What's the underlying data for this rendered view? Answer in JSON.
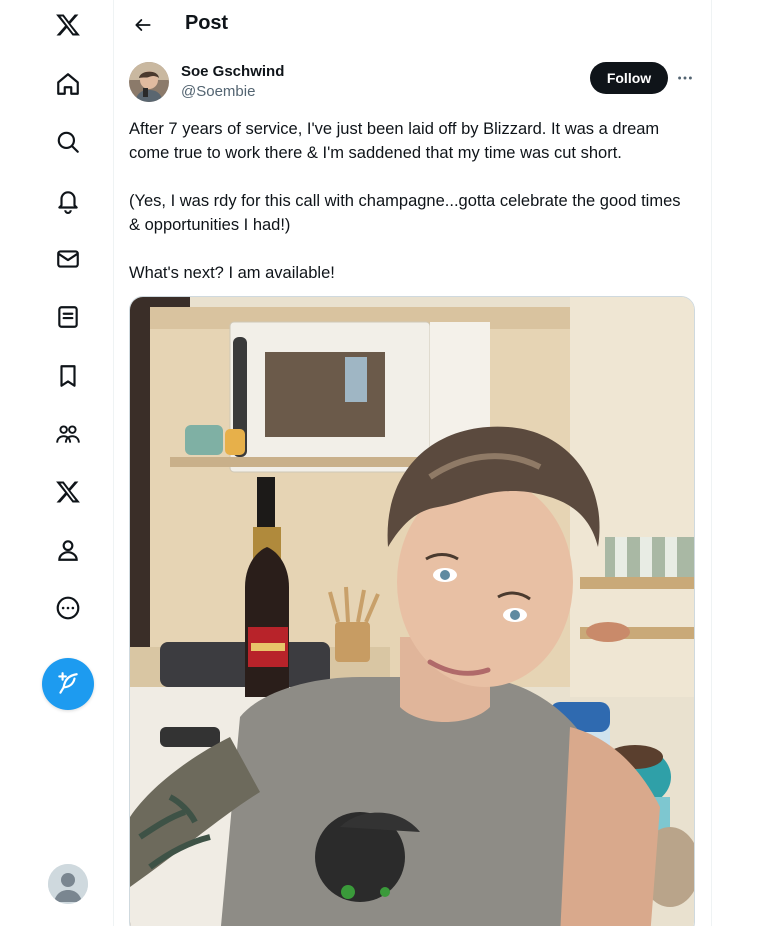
{
  "nav": {
    "items": [
      {
        "name": "x-logo-icon"
      },
      {
        "name": "home-icon"
      },
      {
        "name": "search-icon"
      },
      {
        "name": "notifications-icon"
      },
      {
        "name": "messages-icon"
      },
      {
        "name": "lists-icon"
      },
      {
        "name": "bookmarks-icon"
      },
      {
        "name": "communities-icon"
      },
      {
        "name": "premium-x-icon"
      },
      {
        "name": "profile-icon"
      },
      {
        "name": "more-icon"
      }
    ],
    "post_button_icon": "feather-plus-icon"
  },
  "header": {
    "title": "Post"
  },
  "post": {
    "author_name": "Soe Gschwind",
    "author_handle": "@Soembie",
    "follow_label": "Follow",
    "paragraphs": [
      "After 7 years of service, I've just been laid off by Blizzard. It was a dream come true to work there & I'm saddened that my time was cut short.",
      "(Yes, I was rdy for this call with champagne...gotta celebrate the good times & opportunities I had!)",
      "What's next? I am available!"
    ]
  },
  "colors": {
    "accent": "#1d9bf0",
    "text": "#0f1419",
    "secondary_text": "#536471",
    "follow_bg": "#0f1419"
  }
}
